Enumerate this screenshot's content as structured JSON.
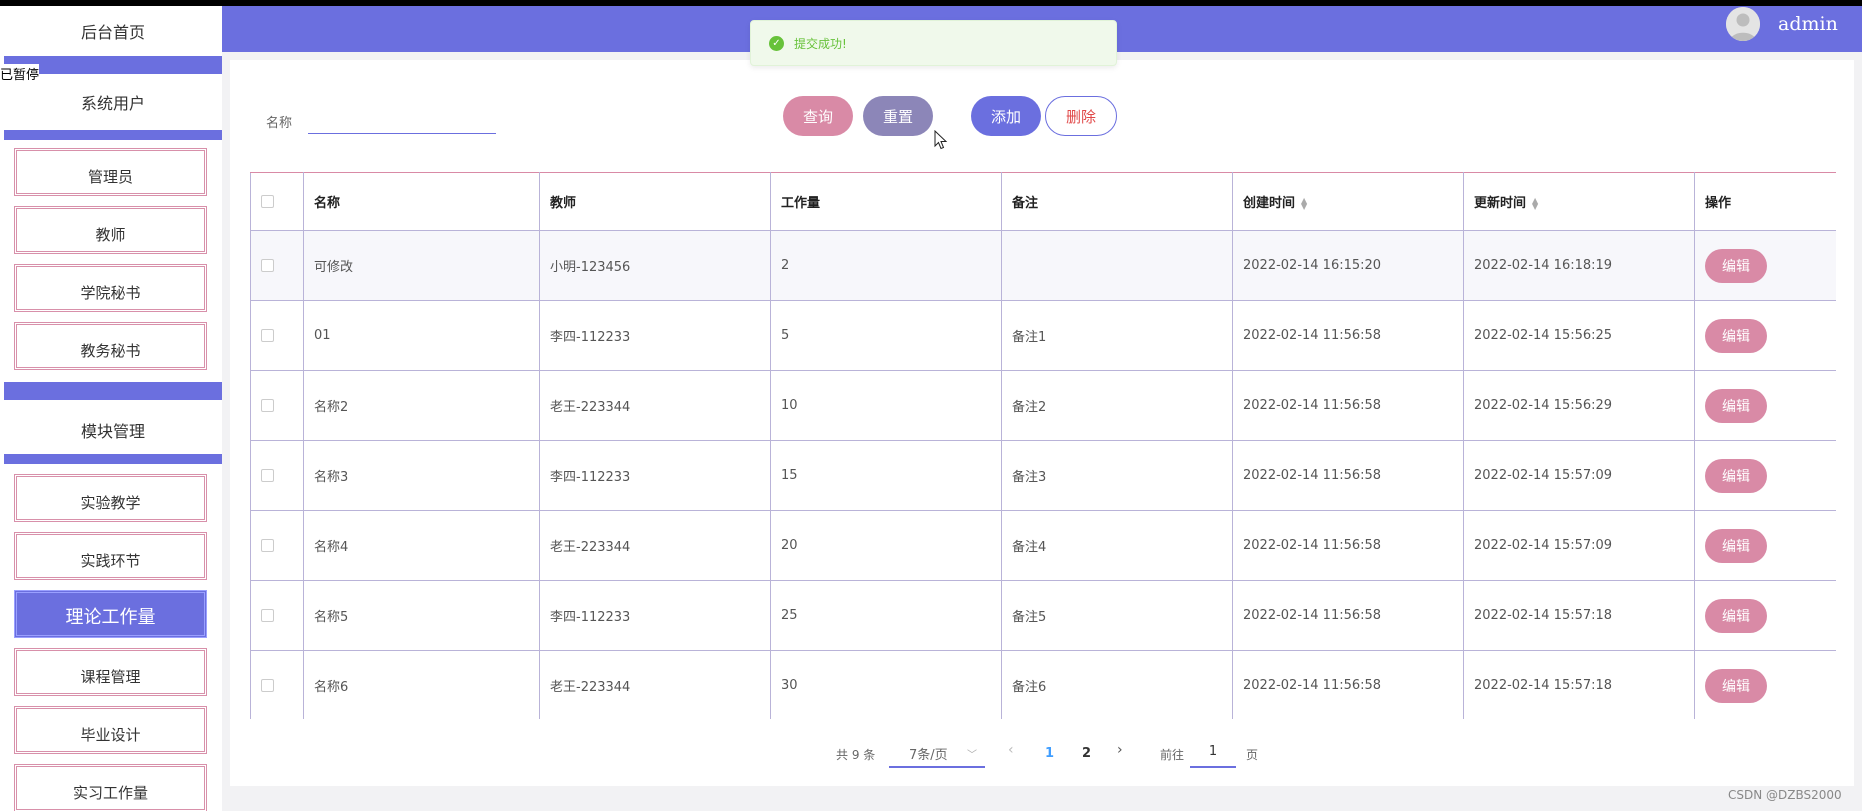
{
  "sidebar": {
    "home": "后台首页",
    "group_users": "系统用户",
    "user_items": [
      "管理员",
      "教师",
      "学院秘书",
      "教务秘书"
    ],
    "group_modules": "模块管理",
    "module_items": [
      "实验教学",
      "实践环节",
      "理论工作量",
      "课程管理",
      "毕业设计",
      "实习工作量"
    ],
    "active_item": "理论工作量",
    "paused_overlay": "已暂停"
  },
  "header": {
    "username": "admin",
    "accent_color": "#6b6fdf"
  },
  "toast": {
    "message": "提交成功!",
    "icon": "check-circle-icon"
  },
  "search": {
    "label": "名称",
    "value": "",
    "query_button": "查询",
    "reset_button": "重置",
    "add_button": "添加",
    "delete_button": "删除"
  },
  "table": {
    "columns": [
      "名称",
      "教师",
      "工作量",
      "备注",
      "创建时间",
      "更新时间",
      "操作"
    ],
    "edit_label": "编辑",
    "rows": [
      {
        "name": "可修改",
        "teacher": "小明-123456",
        "workload": "2",
        "note": "",
        "created": "2022-02-14 16:15:20",
        "updated": "2022-02-14 16:18:19"
      },
      {
        "name": "01",
        "teacher": "李四-112233",
        "workload": "5",
        "note": "备注1",
        "created": "2022-02-14 11:56:58",
        "updated": "2022-02-14 15:56:25"
      },
      {
        "name": "名称2",
        "teacher": "老王-223344",
        "workload": "10",
        "note": "备注2",
        "created": "2022-02-14 11:56:58",
        "updated": "2022-02-14 15:56:29"
      },
      {
        "name": "名称3",
        "teacher": "李四-112233",
        "workload": "15",
        "note": "备注3",
        "created": "2022-02-14 11:56:58",
        "updated": "2022-02-14 15:57:09"
      },
      {
        "name": "名称4",
        "teacher": "老王-223344",
        "workload": "20",
        "note": "备注4",
        "created": "2022-02-14 11:56:58",
        "updated": "2022-02-14 15:57:09"
      },
      {
        "name": "名称5",
        "teacher": "李四-112233",
        "workload": "25",
        "note": "备注5",
        "created": "2022-02-14 11:56:58",
        "updated": "2022-02-14 15:57:18"
      },
      {
        "name": "名称6",
        "teacher": "老王-223344",
        "workload": "30",
        "note": "备注6",
        "created": "2022-02-14 11:56:58",
        "updated": "2022-02-14 15:57:18"
      }
    ]
  },
  "pagination": {
    "total": "共 9 条",
    "page_size": "7条/页",
    "pages": [
      "1",
      "2"
    ],
    "current_page": "1",
    "goto_label": "前往",
    "goto_value": "1",
    "page_suffix": "页"
  },
  "watermark": "CSDN @DZBS2000"
}
